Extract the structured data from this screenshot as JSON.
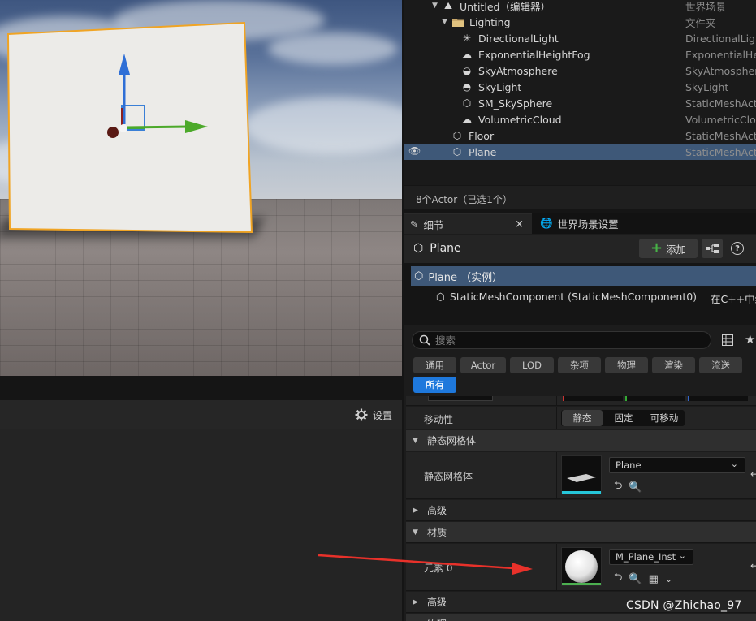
{
  "outliner": {
    "rows": [
      {
        "label": "Untitled（编辑器）",
        "type": "世界场景",
        "icon": "level-icon"
      },
      {
        "label": "Lighting",
        "type": "文件夹",
        "icon": "folder-icon"
      },
      {
        "label": "DirectionalLight",
        "type": "DirectionalLight",
        "icon": "directional-light-icon"
      },
      {
        "label": "ExponentialHeightFog",
        "type": "ExponentialHeightFog",
        "icon": "fog-icon"
      },
      {
        "label": "SkyAtmosphere",
        "type": "SkyAtmosphere",
        "icon": "sky-atmosphere-icon"
      },
      {
        "label": "SkyLight",
        "type": "SkyLight",
        "icon": "sky-light-icon"
      },
      {
        "label": "SM_SkySphere",
        "type": "StaticMeshActor",
        "icon": "static-mesh-icon"
      },
      {
        "label": "VolumetricCloud",
        "type": "VolumetricCloud",
        "icon": "cloud-icon"
      },
      {
        "label": "Floor",
        "type": "StaticMeshActor",
        "icon": "static-mesh-icon"
      },
      {
        "label": "Plane",
        "type": "StaticMeshActor",
        "icon": "static-mesh-icon",
        "selected": true
      }
    ],
    "status": "8个Actor（已选1个）"
  },
  "left_panel": {
    "settings_label": "设置"
  },
  "details": {
    "tab_label": "细节",
    "world_tab_label": "世界场景设置",
    "close": "×",
    "actor_name": "Plane",
    "add_label": "添加",
    "help": "?",
    "component_root": "Plane （实例）",
    "component_child": "StaticMeshComponent (StaticMeshComponent0)",
    "component_link": "在C++中编",
    "search_placeholder": "搜索",
    "filters": [
      "通用",
      "Actor",
      "LOD",
      "杂项",
      "物理",
      "渲染",
      "流送",
      "所有"
    ],
    "mobility_label": "移动性",
    "mobility_options": [
      "静态",
      "固定",
      "可移动"
    ],
    "mobility_selected": "静态",
    "cat_static_mesh": "静态网格体",
    "static_mesh_label": "静态网格体",
    "static_mesh_value": "Plane",
    "advanced_1": "高级",
    "cat_materials": "材质",
    "element0_label": "元素 0",
    "material_value": "M_Plane_Inst",
    "advanced_2": "高级",
    "physics_partial": "物理"
  },
  "watermark": "CSDN @Zhichao_97",
  "colors": {
    "selection": "#3e5878",
    "accent_blue": "#1e78dc",
    "add_green": "#47b347",
    "annotation_red": "#e8312a",
    "mesh_cyan": "#26c6da",
    "material_green": "#4caf50"
  }
}
